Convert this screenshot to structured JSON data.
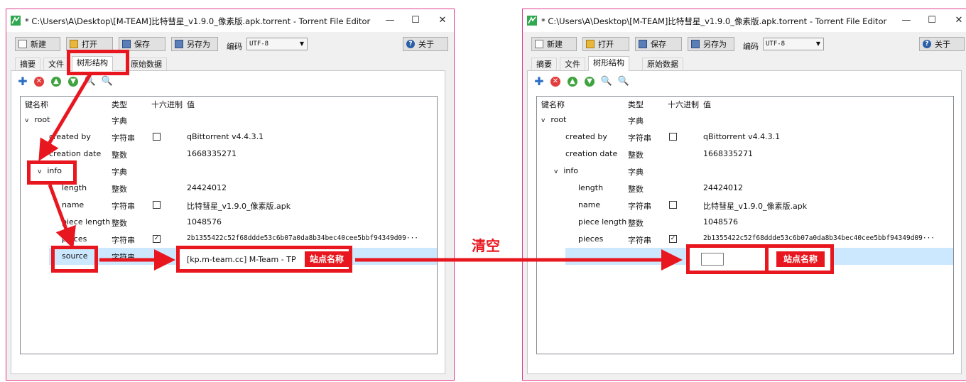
{
  "window": {
    "title": "* C:\\Users\\A\\Desktop\\[M-TEAM]比特彗星_v1.9.0_像素版.apk.torrent - Torrent File Editor",
    "minimize": "—",
    "maximize": "☐",
    "close": "✕"
  },
  "toolbar": {
    "new_label": "新建",
    "open_label": "打开",
    "save_label": "保存",
    "save_as_label": "另存为",
    "encoding_label": "编码",
    "encoding_value": "UTF-8",
    "about_label": "关于"
  },
  "tabs": [
    "摘要",
    "文件",
    "树形结构",
    "原始数据"
  ],
  "columns": {
    "key": "键名称",
    "type": "类型",
    "hex": "十六进制",
    "value": "值"
  },
  "rows": [
    {
      "key": "root",
      "type": "字典",
      "value": ""
    },
    {
      "key": "created by",
      "type": "字符串",
      "value": "qBittorrent v4.4.3.1"
    },
    {
      "key": "creation date",
      "type": "整数",
      "value": "1668335271"
    },
    {
      "key": "info",
      "type": "字典",
      "value": ""
    },
    {
      "key": "length",
      "type": "整数",
      "value": "24424012"
    },
    {
      "key": "name",
      "type": "字符串",
      "value": "比特彗星_v1.9.0_像素版.apk"
    },
    {
      "key": "piece length",
      "type": "整数",
      "value": "1048576"
    },
    {
      "key": "pieces",
      "type": "字符串",
      "value": "2b1355422c52f68ddde53c6b07a0da8b34bec40cee5bbf94349d09···"
    },
    {
      "key": "source",
      "type": "字符串",
      "value": "[kp.m-team.cc] M-Team - TP"
    }
  ],
  "annotations": {
    "site_name": "站点名称",
    "clear": "清空"
  },
  "colors": {
    "highlight": "#e8171f",
    "selection": "#cce8ff",
    "window_border": "#e23d8c"
  }
}
